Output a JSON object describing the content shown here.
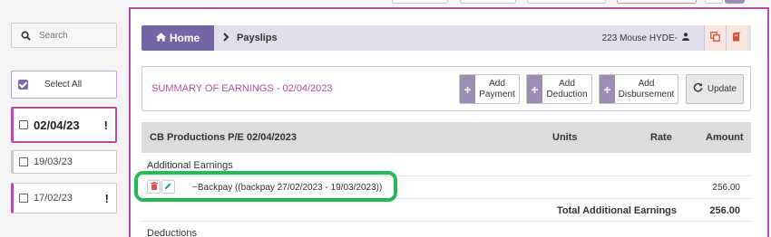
{
  "search": {
    "placeholder": "Search"
  },
  "select_all": {
    "label": "Select All"
  },
  "periods": [
    {
      "date": "02/04/23",
      "flag": "!"
    },
    {
      "date": "19/03/23",
      "flag": ""
    },
    {
      "date": "17/02/23",
      "flag": "!"
    }
  ],
  "breadcrumb": {
    "home": "Home",
    "current": "Payslips",
    "user": "223 Mouse HYDE-"
  },
  "summary": {
    "title": "SUMMARY OF EARNINGS - 02/04/2023",
    "buttons": {
      "add_payment": [
        "Add",
        "Payment"
      ],
      "add_deduction": [
        "Add",
        "Deduction"
      ],
      "add_disbursement": [
        "Add",
        "Disbursement"
      ],
      "update": "Update"
    }
  },
  "table": {
    "headers": {
      "name": "CB Productions P/E 02/04/2023",
      "units": "Units",
      "rate": "Rate",
      "amount": "Amount"
    },
    "section1": "Additional Earnings",
    "item": {
      "description": "~Backpay ((backpay 27/02/2023 - 19/03/2023))",
      "amount": "256.00"
    },
    "total": {
      "label": "Total Additional Earnings",
      "amount": "256.00"
    },
    "section2": "Deductions"
  },
  "colors": {
    "accent": "#b84ca5",
    "primary": "#7466a5",
    "highlight": "#22bb55"
  }
}
